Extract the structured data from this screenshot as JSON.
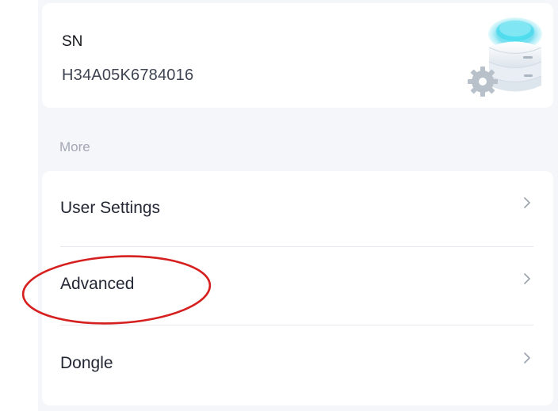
{
  "device": {
    "sn_label": "SN",
    "sn_value": "H34A05K6784016",
    "image_icon": "device-stack-gear-icon"
  },
  "more_section": {
    "heading": "More",
    "items": [
      {
        "label": "User Settings",
        "icon": "chevron-right-icon"
      },
      {
        "label": "Advanced",
        "icon": "chevron-right-icon"
      },
      {
        "label": "Dongle",
        "icon": "chevron-right-icon"
      }
    ]
  },
  "annotation": {
    "shape": "ellipse",
    "color": "#d61f1f",
    "target": "Advanced"
  },
  "colors": {
    "panel_background": "#f4f6fa",
    "card_background": "#ffffff",
    "device_glow": "#46d8ee"
  }
}
